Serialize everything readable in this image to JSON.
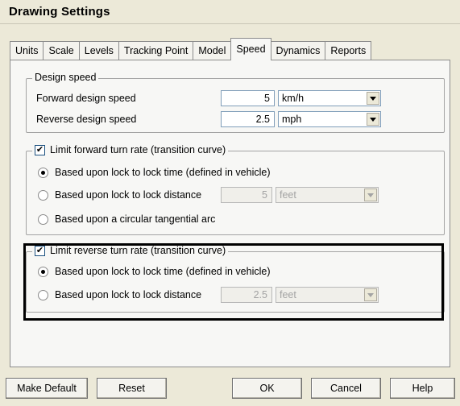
{
  "window": {
    "title": "Drawing Settings"
  },
  "tabs": [
    {
      "label": "Units"
    },
    {
      "label": "Scale"
    },
    {
      "label": "Levels"
    },
    {
      "label": "Tracking Point"
    },
    {
      "label": "Model"
    },
    {
      "label": "Speed",
      "active": true
    },
    {
      "label": "Dynamics"
    },
    {
      "label": "Reports"
    }
  ],
  "design_speed": {
    "legend": "Design speed",
    "forward": {
      "label": "Forward design speed",
      "value": "5",
      "unit": "km/h"
    },
    "reverse": {
      "label": "Reverse design speed",
      "value": "2.5",
      "unit": "mph"
    }
  },
  "forward_turn": {
    "checked": true,
    "check_mark": "✔",
    "legend": "Limit forward turn rate (transition curve)",
    "option_time": "Based upon lock to lock time (defined in vehicle)",
    "option_distance": "Based upon lock to lock distance",
    "distance_value": "5",
    "distance_unit": "feet",
    "option_arc": "Based upon a circular tangential arc",
    "selected": "time"
  },
  "reverse_turn": {
    "checked": true,
    "check_mark": "✔",
    "legend": "Limit reverse turn rate (transition curve)",
    "option_time": "Based upon lock to lock time (defined in vehicle)",
    "option_distance": "Based upon lock to lock distance",
    "distance_value": "2.5",
    "distance_unit": "feet",
    "selected": "time"
  },
  "buttons": {
    "make_default": "Make Default",
    "reset": "Reset",
    "ok": "OK",
    "cancel": "Cancel",
    "help": "Help"
  },
  "colors": {
    "dialog_bg": "#ece9d8",
    "panel_bg": "#f7f7f5",
    "highlight_border": "#000000"
  }
}
